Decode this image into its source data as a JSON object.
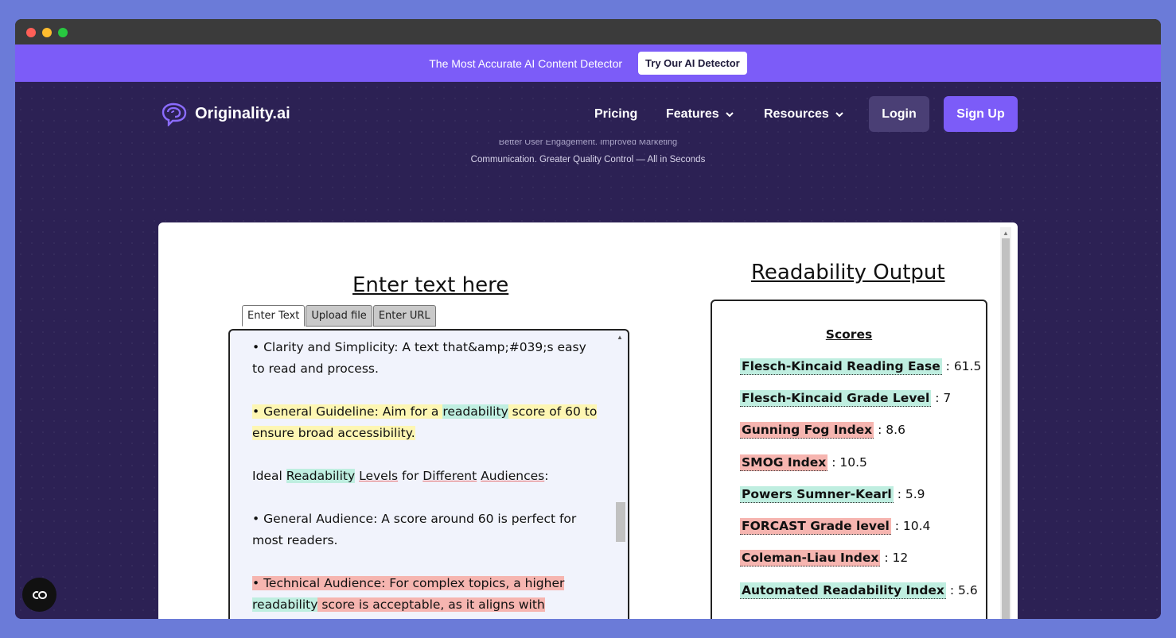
{
  "promo": {
    "text": "The Most Accurate AI Content Detector",
    "button": "Try Our AI Detector"
  },
  "nav": {
    "logo": "Originality.ai",
    "items": [
      "Pricing",
      "Features",
      "Resources"
    ],
    "login": "Login",
    "signup": "Sign Up"
  },
  "hero": {
    "subtitle_line1": "Better User Engagement. Improved Marketing",
    "subtitle_line2": "Communication. Greater Quality Control — All in Seconds"
  },
  "input": {
    "title": "Enter text here",
    "tabs": [
      "Enter Text",
      "Upload file",
      "Enter URL"
    ],
    "paragraphs": {
      "p1": "• Clarity and Simplicity: A text that&amp;#039;s easy to read and process.",
      "p2a": "• General Guideline: Aim for a ",
      "p2b": "readability",
      "p2c": " score of 60 to ensure broad accessibility.",
      "p3a": "Ideal ",
      "p3b": "Readability",
      "p3c": "Levels",
      "p3d": "for",
      "p3e": "Different",
      "p3f": "Audiences",
      "p3g": ":",
      "p4": "• General Audience: A score around 60 is perfect for most readers.",
      "p5a": "• Technical Audience: For complex topics, a higher ",
      "p5b": "readability",
      "p5c": " score is acceptable, as it aligns with"
    }
  },
  "output": {
    "title": "Readability Output",
    "scores_title": "Scores",
    "scores": [
      {
        "name": "Flesch-Kincaid Reading Ease",
        "value": ": 61.5",
        "color": "#bfeee0"
      },
      {
        "name": "Flesch-Kincaid Grade Level",
        "value": ": 7",
        "color": "#bfeee0"
      },
      {
        "name": "Gunning Fog Index",
        "value": ": 8.6",
        "color": "#f6b5b0"
      },
      {
        "name": "SMOG Index",
        "value": ": 10.5",
        "color": "#f6b5b0"
      },
      {
        "name": "Powers Sumner-Kearl",
        "value": ": 5.9",
        "color": "#bfeee0"
      },
      {
        "name": "FORCAST Grade level",
        "value": ": 10.4",
        "color": "#f6b5b0"
      },
      {
        "name": "Coleman-Liau Index",
        "value": ": 12",
        "color": "#f6b5b0"
      },
      {
        "name": "Automated Readability Index",
        "value": ": 5.6",
        "color": "#bfeee0"
      }
    ]
  },
  "colors": {
    "accent": "#7c5cf8",
    "background": "#2c2154",
    "page": "#6b7bd8"
  },
  "icons": {
    "logo": "brain-icon",
    "chevron": "chevron-down-icon",
    "chat": "chat-icon"
  }
}
